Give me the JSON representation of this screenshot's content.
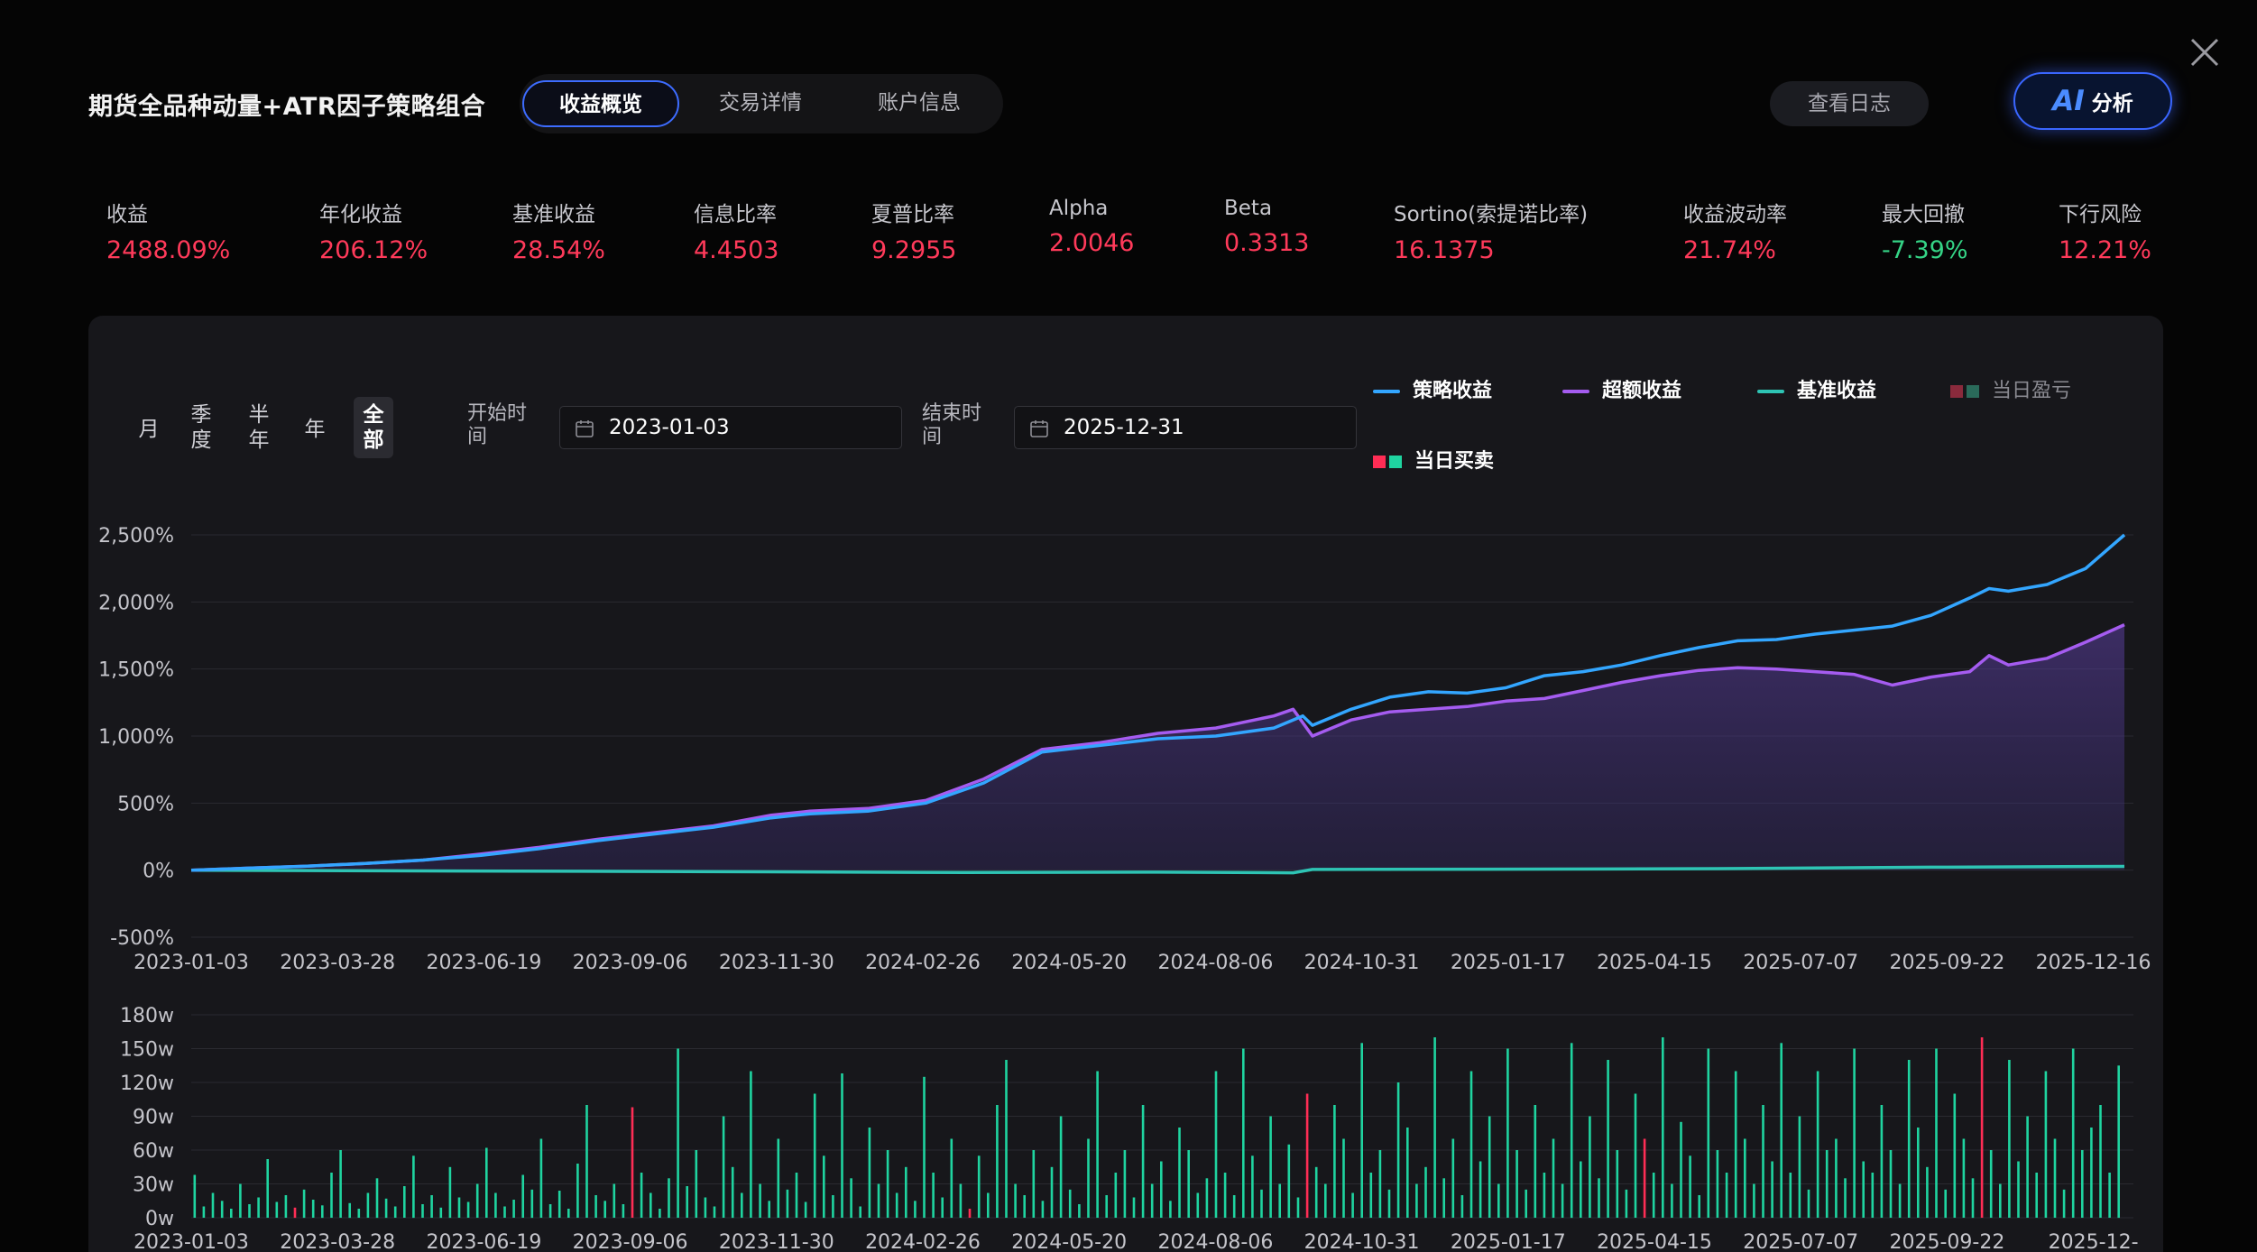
{
  "header": {
    "title": "期货全品种动量+ATR因子策略组合",
    "tabs": [
      {
        "label": "收益概览",
        "active": true
      },
      {
        "label": "交易详情",
        "active": false
      },
      {
        "label": "账户信息",
        "active": false
      }
    ],
    "log_button": "查看日志",
    "ai_mark": "AI",
    "ai_label": "分析",
    "close_icon": "close-icon"
  },
  "metrics": [
    {
      "label": "收益",
      "value": "2488.09%",
      "tone": "red"
    },
    {
      "label": "年化收益",
      "value": "206.12%",
      "tone": "red"
    },
    {
      "label": "基准收益",
      "value": "28.54%",
      "tone": "red"
    },
    {
      "label": "信息比率",
      "value": "4.4503",
      "tone": "red"
    },
    {
      "label": "夏普比率",
      "value": "9.2955",
      "tone": "red"
    },
    {
      "label": "Alpha",
      "value": "2.0046",
      "tone": "red"
    },
    {
      "label": "Beta",
      "value": "0.3313",
      "tone": "red"
    },
    {
      "label": "Sortino(索提诺比率)",
      "value": "16.1375",
      "tone": "red"
    },
    {
      "label": "收益波动率",
      "value": "21.74%",
      "tone": "red"
    },
    {
      "label": "最大回撤",
      "value": "-7.39%",
      "tone": "green"
    },
    {
      "label": "下行风险",
      "value": "12.21%",
      "tone": "red"
    }
  ],
  "controls": {
    "periods": [
      {
        "label": "月",
        "active": false
      },
      {
        "label": "季度",
        "active": false
      },
      {
        "label": "半年",
        "active": false
      },
      {
        "label": "年",
        "active": false
      },
      {
        "label": "全部",
        "active": true
      }
    ],
    "start_label": "开始时间",
    "start_date": "2023-01-03",
    "end_label": "结束时间",
    "end_date": "2025-12-31",
    "calendar_icon": "calendar-icon"
  },
  "legend": [
    {
      "label": "策略收益",
      "color": "#33a6ff",
      "kind": "line"
    },
    {
      "label": "超额收益",
      "color": "#a55cf0",
      "kind": "line"
    },
    {
      "label": "基准收益",
      "color": "#2ec4b4",
      "kind": "line"
    },
    {
      "label": "当日盈亏",
      "colors": [
        "#8a2a3c",
        "#2a6a5a"
      ],
      "kind": "squares",
      "muted": true
    },
    {
      "label": "当日买卖",
      "colors": [
        "#ff2d55",
        "#1fd4a0"
      ],
      "kind": "squares"
    }
  ],
  "colors": {
    "strategy": "#33a6ff",
    "excess": "#a55cf0",
    "benchmark": "#2ec4b4",
    "buy": "#ff2d55",
    "sell": "#1fd4a0",
    "accent": "#3d6cff",
    "positive": "#ff3a5a",
    "negative": "#35d486"
  },
  "chart_data": [
    {
      "type": "line",
      "ylim": [
        -500,
        2500
      ],
      "y_ticks": [
        "-500%",
        "0%",
        "500%",
        "1,000%",
        "1,500%",
        "2,000%",
        "2,500%"
      ],
      "x_ticks": [
        "2023-01-03",
        "2023-03-28",
        "2023-06-19",
        "2023-09-06",
        "2023-11-30",
        "2024-02-26",
        "2024-05-20",
        "2024-08-06",
        "2024-10-31",
        "2025-01-17",
        "2025-04-15",
        "2025-07-07",
        "2025-09-22",
        "2025-12-16"
      ],
      "series": [
        {
          "name": "策略收益",
          "points": [
            [
              0,
              0
            ],
            [
              0.03,
              15
            ],
            [
              0.06,
              30
            ],
            [
              0.09,
              50
            ],
            [
              0.12,
              75
            ],
            [
              0.15,
              110
            ],
            [
              0.18,
              160
            ],
            [
              0.21,
              220
            ],
            [
              0.24,
              270
            ],
            [
              0.27,
              320
            ],
            [
              0.3,
              390
            ],
            [
              0.32,
              420
            ],
            [
              0.35,
              440
            ],
            [
              0.38,
              500
            ],
            [
              0.41,
              650
            ],
            [
              0.44,
              880
            ],
            [
              0.47,
              930
            ],
            [
              0.5,
              980
            ],
            [
              0.53,
              1000
            ],
            [
              0.56,
              1060
            ],
            [
              0.575,
              1150
            ],
            [
              0.58,
              1080
            ],
            [
              0.6,
              1200
            ],
            [
              0.62,
              1290
            ],
            [
              0.64,
              1330
            ],
            [
              0.66,
              1320
            ],
            [
              0.68,
              1360
            ],
            [
              0.7,
              1450
            ],
            [
              0.72,
              1480
            ],
            [
              0.74,
              1530
            ],
            [
              0.76,
              1600
            ],
            [
              0.78,
              1660
            ],
            [
              0.8,
              1710
            ],
            [
              0.82,
              1720
            ],
            [
              0.84,
              1760
            ],
            [
              0.86,
              1790
            ],
            [
              0.88,
              1820
            ],
            [
              0.9,
              1900
            ],
            [
              0.92,
              2030
            ],
            [
              0.93,
              2100
            ],
            [
              0.94,
              2080
            ],
            [
              0.96,
              2130
            ],
            [
              0.98,
              2250
            ],
            [
              1.0,
              2500
            ]
          ]
        },
        {
          "name": "超额收益",
          "points": [
            [
              0,
              0
            ],
            [
              0.03,
              15
            ],
            [
              0.06,
              30
            ],
            [
              0.09,
              50
            ],
            [
              0.12,
              75
            ],
            [
              0.15,
              120
            ],
            [
              0.18,
              170
            ],
            [
              0.21,
              230
            ],
            [
              0.24,
              280
            ],
            [
              0.27,
              330
            ],
            [
              0.3,
              410
            ],
            [
              0.32,
              440
            ],
            [
              0.35,
              460
            ],
            [
              0.38,
              520
            ],
            [
              0.41,
              680
            ],
            [
              0.44,
              900
            ],
            [
              0.47,
              950
            ],
            [
              0.5,
              1020
            ],
            [
              0.53,
              1060
            ],
            [
              0.56,
              1150
            ],
            [
              0.57,
              1200
            ],
            [
              0.58,
              1000
            ],
            [
              0.6,
              1120
            ],
            [
              0.62,
              1180
            ],
            [
              0.64,
              1200
            ],
            [
              0.66,
              1220
            ],
            [
              0.68,
              1260
            ],
            [
              0.7,
              1280
            ],
            [
              0.72,
              1340
            ],
            [
              0.74,
              1400
            ],
            [
              0.76,
              1450
            ],
            [
              0.78,
              1490
            ],
            [
              0.8,
              1510
            ],
            [
              0.82,
              1500
            ],
            [
              0.84,
              1480
            ],
            [
              0.86,
              1460
            ],
            [
              0.88,
              1380
            ],
            [
              0.9,
              1440
            ],
            [
              0.92,
              1480
            ],
            [
              0.93,
              1600
            ],
            [
              0.94,
              1530
            ],
            [
              0.96,
              1580
            ],
            [
              0.98,
              1700
            ],
            [
              1.0,
              1830
            ]
          ]
        },
        {
          "name": "基准收益",
          "points": [
            [
              0,
              0
            ],
            [
              0.1,
              -5
            ],
            [
              0.2,
              -8
            ],
            [
              0.3,
              -12
            ],
            [
              0.4,
              -18
            ],
            [
              0.5,
              -15
            ],
            [
              0.57,
              -20
            ],
            [
              0.58,
              5
            ],
            [
              0.7,
              8
            ],
            [
              0.8,
              12
            ],
            [
              0.9,
              22
            ],
            [
              1.0,
              28
            ]
          ]
        }
      ]
    },
    {
      "type": "bar",
      "ylim": [
        0,
        180
      ],
      "y_ticks": [
        "0w",
        "30w",
        "60w",
        "90w",
        "120w",
        "150w",
        "180w"
      ],
      "x_ticks": [
        "2023-01-03",
        "2023-03-28",
        "2023-06-19",
        "2023-09-06",
        "2023-11-30",
        "2024-02-26",
        "2024-05-20",
        "2024-08-06",
        "2024-10-31",
        "2025-01-17",
        "2025-04-15",
        "2025-07-07",
        "2025-09-22",
        "2025-12-"
      ],
      "series": [
        {
          "name": "当日买卖",
          "values": [
            38,
            10,
            22,
            15,
            8,
            30,
            12,
            18,
            52,
            14,
            20,
            9,
            25,
            16,
            11,
            40,
            60,
            13,
            8,
            22,
            35,
            17,
            10,
            28,
            55,
            12,
            20,
            9,
            45,
            18,
            14,
            30,
            62,
            22,
            10,
            16,
            38,
            25,
            70,
            12,
            24,
            8,
            48,
            100,
            20,
            15,
            30,
            12,
            98,
            40,
            22,
            8,
            35,
            150,
            28,
            60,
            18,
            10,
            90,
            45,
            22,
            130,
            30,
            15,
            70,
            25,
            40,
            14,
            110,
            55,
            20,
            128,
            35,
            10,
            80,
            30,
            60,
            22,
            45,
            15,
            125,
            40,
            18,
            70,
            30,
            8,
            55,
            22,
            100,
            140,
            30,
            20,
            60,
            15,
            45,
            90,
            25,
            12,
            70,
            130,
            20,
            40,
            60,
            18,
            100,
            30,
            50,
            15,
            80,
            60,
            22,
            35,
            130,
            40,
            20,
            150,
            55,
            25,
            90,
            30,
            65,
            18,
            110,
            45,
            30,
            100,
            70,
            22,
            155,
            40,
            60,
            25,
            120,
            80,
            30,
            45,
            160,
            35,
            70,
            20,
            130,
            50,
            90,
            30,
            150,
            60,
            25,
            100,
            40,
            70,
            30,
            155,
            50,
            90,
            35,
            140,
            60,
            25,
            110,
            70,
            40,
            160,
            30,
            85,
            55,
            20,
            150,
            60,
            40,
            130,
            70,
            30,
            100,
            50,
            155,
            40,
            90,
            25,
            130,
            60,
            70,
            35,
            150,
            50,
            40,
            100,
            60,
            30,
            140,
            80,
            45,
            150,
            25,
            110,
            70,
            35,
            160,
            60,
            30,
            140,
            50,
            90,
            40,
            130,
            70,
            25,
            150,
            60,
            80,
            100,
            40,
            135
          ]
        }
      ]
    }
  ]
}
